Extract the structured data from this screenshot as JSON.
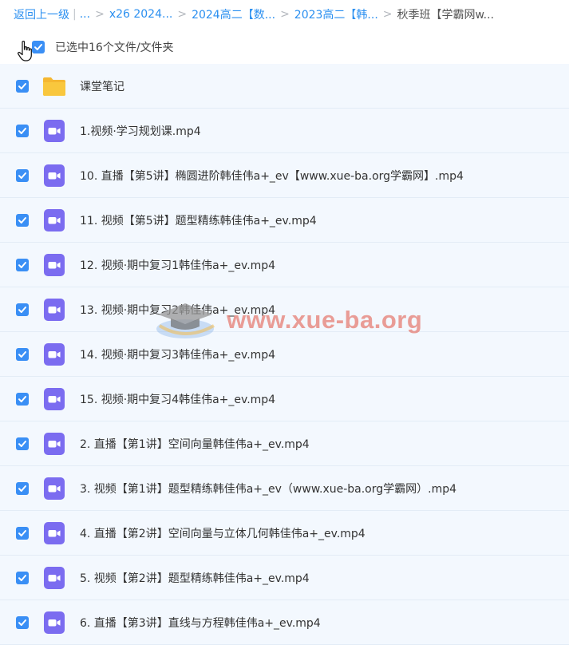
{
  "breadcrumb": {
    "back": "返回上一级",
    "ellipsis": "...",
    "items": [
      "x26 2024...",
      "2024高二【数...",
      "2023高二【韩...",
      "秋季班【学霸网w..."
    ]
  },
  "selection": {
    "label": "已选中16个文件/文件夹"
  },
  "files": [
    {
      "name": "课堂笔记",
      "type": "folder"
    },
    {
      "name": "1.视频·学习规划课.mp4",
      "type": "video"
    },
    {
      "name": "10. 直播【第5讲】椭圆进阶韩佳伟a+_ev【www.xue-ba.org学霸网】.mp4",
      "type": "video"
    },
    {
      "name": "11. 视频【第5讲】题型精练韩佳伟a+_ev.mp4",
      "type": "video"
    },
    {
      "name": "12. 视频·期中复习1韩佳伟a+_ev.mp4",
      "type": "video"
    },
    {
      "name": "13. 视频·期中复习2韩佳伟a+_ev.mp4",
      "type": "video"
    },
    {
      "name": "14. 视频·期中复习3韩佳伟a+_ev.mp4",
      "type": "video"
    },
    {
      "name": "15. 视频·期中复习4韩佳伟a+_ev.mp4",
      "type": "video"
    },
    {
      "name": "2. 直播【第1讲】空间向量韩佳伟a+_ev.mp4",
      "type": "video"
    },
    {
      "name": "3. 视频【第1讲】题型精练韩佳伟a+_ev（www.xue-ba.org学霸网）.mp4",
      "type": "video"
    },
    {
      "name": "4. 直播【第2讲】空间向量与立体几何韩佳伟a+_ev.mp4",
      "type": "video"
    },
    {
      "name": "5. 视频【第2讲】题型精练韩佳伟a+_ev.mp4",
      "type": "video"
    },
    {
      "name": "6. 直播【第3讲】直线与方程韩佳伟a+_ev.mp4",
      "type": "video"
    }
  ],
  "watermark": {
    "text": "www.xue-ba.org"
  },
  "colors": {
    "accent": "#3a8ff5",
    "video_icon": "#7b6cf0",
    "folder_icon": "#f9c73d",
    "row_bg": "#f3f8fe"
  }
}
